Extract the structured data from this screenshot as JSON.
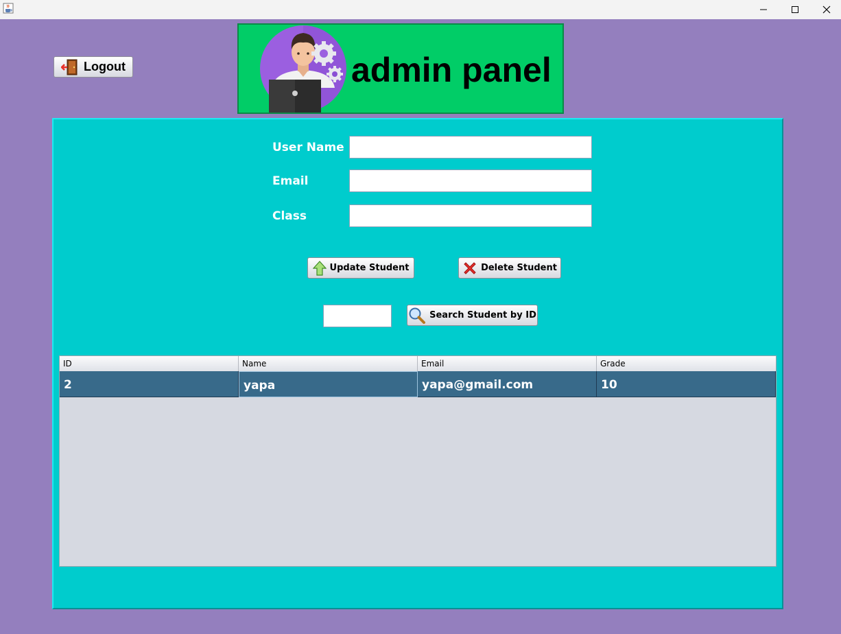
{
  "window": {
    "app_icon": "java-cup-icon",
    "controls": [
      "minimize-icon",
      "maximize-icon",
      "close-icon"
    ]
  },
  "header": {
    "logout_label": "Logout",
    "banner_title": "admin panel",
    "banner_color": "#01cd67"
  },
  "form": {
    "username_label": "User Name",
    "username_value": "",
    "email_label": "Email",
    "email_value": "",
    "class_label": "Class",
    "class_value": ""
  },
  "actions": {
    "update_label": "Update Student",
    "delete_label": "Delete Student",
    "search_id_value": "",
    "search_label": "Search Student by ID"
  },
  "table": {
    "columns": [
      "ID",
      "Name",
      "Email",
      "Grade"
    ],
    "rows": [
      [
        "2",
        "yapa",
        "yapa@gmail.com",
        "10"
      ]
    ]
  },
  "colors": {
    "window_bg": "#947fbe",
    "panel_bg": "#00cccd",
    "selected_row": "#386a8a"
  }
}
